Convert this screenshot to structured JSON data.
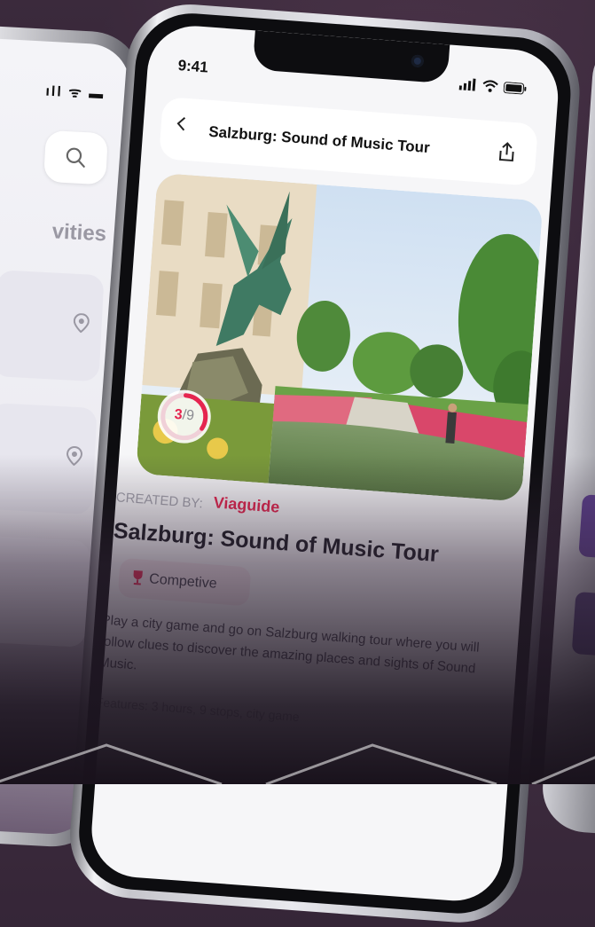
{
  "left_phone": {
    "section_title_fragment": "vities",
    "search_icon": "search-icon"
  },
  "main_phone": {
    "status_bar": {
      "time": "9:41"
    },
    "nav": {
      "title": "Salzburg: Sound of Music Tour",
      "back_icon": "chevron-left-icon",
      "share_icon": "share-icon"
    },
    "hero": {
      "progress_current": "3",
      "progress_separator": "/",
      "progress_total": "9",
      "progress_fraction": 0.333
    },
    "created_by_label": "CREATED BY:",
    "creator_name": "Viaguide",
    "tour_title": "Salzburg: Sound of Music Tour",
    "tag": {
      "label": "Competive",
      "icon": "trophy-icon"
    },
    "description": "Play a city game and go on Salzburg walking tour where you will follow clues to discover the amazing places and sights of Sound Music.",
    "description_more": "Features: 3 hours, 9 stops, city game"
  },
  "colors": {
    "accent": "#e5254f",
    "background": "#2c1f30"
  }
}
